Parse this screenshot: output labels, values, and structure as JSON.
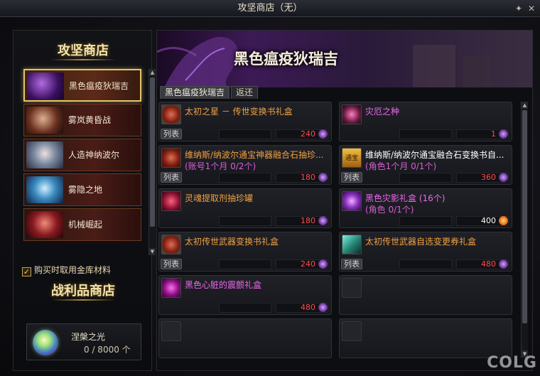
{
  "window": {
    "title": "攻坚商店（无）"
  },
  "left": {
    "section1_title": "攻坚商店",
    "shops": [
      {
        "label": "黑色瘟疫狄瑞吉",
        "active": true
      },
      {
        "label": "雾岚黄昏战",
        "active": false
      },
      {
        "label": "人造神纳波尔",
        "active": false
      },
      {
        "label": "雾隐之地",
        "active": false
      },
      {
        "label": "机械崛起",
        "active": false
      }
    ],
    "checkbox_label": "购买时取用金库材料",
    "checkbox_checked": true,
    "section2_title": "战利品商店",
    "currency": {
      "name": "涅槃之光",
      "value": "0 / 8000 个"
    }
  },
  "right": {
    "banner_title": "黑色瘟疫狄瑞吉",
    "tabs": [
      {
        "label": "黑色瘟疫狄瑞吉",
        "active": true
      },
      {
        "label": "返还",
        "active": false
      }
    ],
    "items": [
      {
        "title": "太初之星 － 传世变换书礼盒",
        "title_color": "orange",
        "sub": "",
        "list_button": "列表",
        "price": "240",
        "price_color": "red",
        "currency_icon": "legend-icon"
      },
      {
        "title": "灾厄之种",
        "title_color": "magenta",
        "sub": "",
        "list_button": "",
        "price": "1",
        "price_color": "red",
        "currency_icon": "legend-icon"
      },
      {
        "title": "维纳斯/纳波尔通宝神器融合石抽珍...",
        "title_color": "orange",
        "sub": "(账号1个月 0/2个)",
        "list_button": "列表",
        "price": "180",
        "price_color": "red",
        "currency_icon": "legend-icon"
      },
      {
        "title": "维纳斯/纳波尔通宝融合石变换书自...",
        "title_color": "white",
        "sub": "(角色1个月 0/1个)",
        "list_button": "列表",
        "price": "360",
        "price_color": "red",
        "currency_icon": "legend-icon",
        "icon_text": "通宝"
      },
      {
        "title": "灵魂提取剂抽珍罐",
        "title_color": "orange",
        "sub": "",
        "list_button": "",
        "price": "180",
        "price_color": "red",
        "currency_icon": "legend-icon"
      },
      {
        "title": "黑色灾影礼盒 (16个)",
        "title_color": "magenta",
        "sub": "(角色 0/1个)",
        "list_button": "",
        "price": "400",
        "price_color": "white",
        "currency_icon": "flame-icon"
      },
      {
        "title": "太初传世武器变换书礼盒",
        "title_color": "orange",
        "sub": "",
        "list_button": "列表",
        "price": "240",
        "price_color": "red",
        "currency_icon": "legend-icon"
      },
      {
        "title": "太初传世武器自选变更券礼盒",
        "title_color": "orange",
        "sub": "",
        "list_button": "列表",
        "price": "480",
        "price_color": "red",
        "currency_icon": "legend-icon"
      },
      {
        "title": "黑色心脏的震颤礼盒",
        "title_color": "magenta",
        "sub": "",
        "list_button": "",
        "price": "480",
        "price_color": "red",
        "currency_icon": "legend-icon"
      },
      {
        "title": "",
        "empty": true
      },
      {
        "title": "",
        "empty": true
      },
      {
        "title": "",
        "empty": true
      }
    ]
  },
  "watermark": "COLG"
}
